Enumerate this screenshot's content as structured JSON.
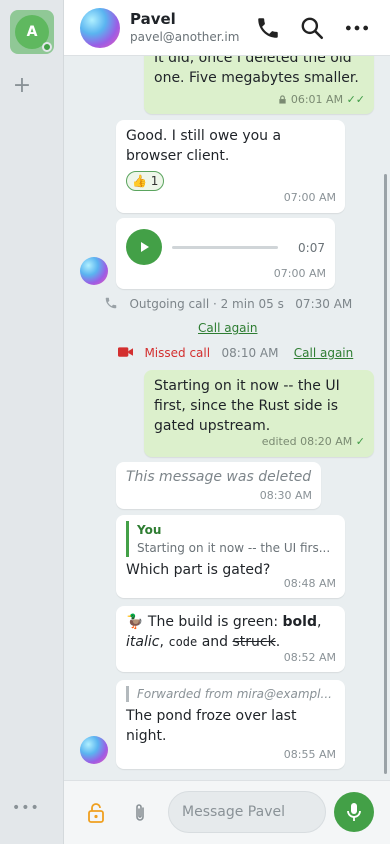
{
  "rail": {
    "account_initial": "A",
    "add_label": "+",
    "more_label": "•••"
  },
  "header": {
    "name": "Pavel",
    "address": "pavel@another.im"
  },
  "messages": {
    "m1": {
      "text": "It did, once I deleted the old one. Five megabytes smaller.",
      "time": "06:01 AM",
      "check": "✓✓"
    },
    "m2": {
      "text": "Good. I still owe you a browser client.",
      "reaction_emoji": "👍",
      "reaction_count": "1",
      "time": "07:00 AM"
    },
    "voice": {
      "duration": "0:07",
      "time": "07:00 AM"
    },
    "call_out": {
      "text": "Outgoing call · 2 min 05 s",
      "time": "07:30 AM",
      "action": "Call again"
    },
    "call_missed": {
      "text": "Missed call",
      "time": "08:10 AM",
      "action": "Call again"
    },
    "m3": {
      "text": "Starting on it now -- the UI first, since the Rust side is gated upstream.",
      "time": "edited 08:20 AM",
      "check": "✓"
    },
    "m4": {
      "text": "This message was deleted",
      "time": "08:30 AM"
    },
    "m5": {
      "quote_author": "You",
      "quote_text": "Starting on it now -- the UI firs...",
      "text": "Which part is gated?",
      "time": "08:48 AM"
    },
    "m6": {
      "emoji": "🦆",
      "t1": " The build is green: ",
      "bold": "bold",
      "t2": ",",
      "italic": "italic",
      "t3": ", ",
      "code": "code",
      "t4": " and ",
      "strike": "struck",
      "t5": ".",
      "time": "08:52 AM"
    },
    "m7": {
      "forwarded": "Forwarded from mira@exampl...",
      "text": "The pond froze over last night.",
      "time": "08:55 AM"
    }
  },
  "composer": {
    "placeholder": "Message Pavel"
  },
  "colors": {
    "accent": "#43a047",
    "outgoing_bubble": "#dcf0cc",
    "missed": "#d32f2f"
  }
}
